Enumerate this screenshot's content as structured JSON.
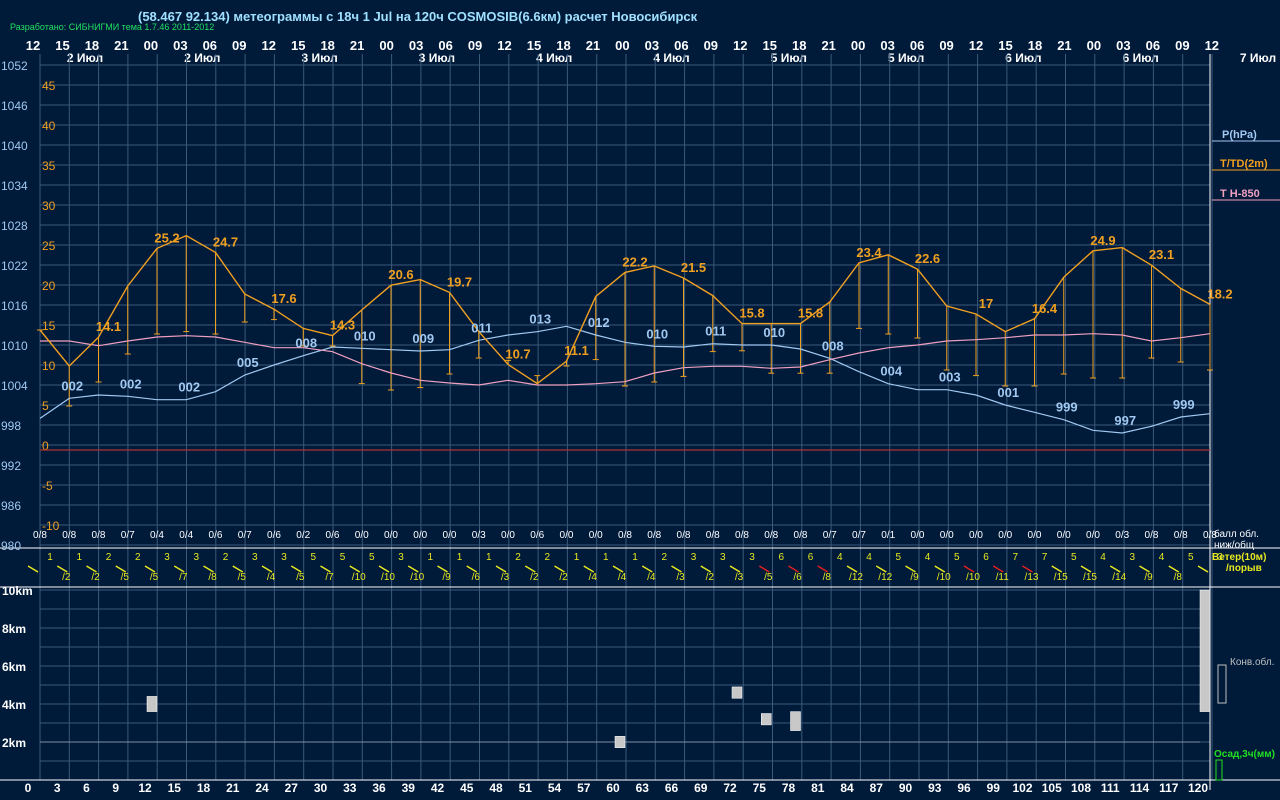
{
  "header": {
    "title": "(58.467 92.134) метеограммы с  18ч 1 Jul на 120ч COSMOSIB(6.6км) расчет Новосибирск",
    "credit": "Разработано: СИБНИГМИ тема 1.7.46 2011-2012"
  },
  "colors": {
    "bg": "#001a3a",
    "grid": "#3a5a7a",
    "pressure": "#a0c8f0",
    "temp": "#f0a020",
    "t850": "#f0a0c0",
    "wind": "#e8e820",
    "wind_strong": "#e02020",
    "cloud": "#c8c8c8",
    "precip": "#20e020",
    "zero": "#b03030",
    "text": "#ffffff",
    "label_blue": "#a0c8f0",
    "label_orange": "#f0a020",
    "label_pink": "#f0a0c0",
    "label_yellow": "#e8e820"
  },
  "chart_data": {
    "type": "line",
    "top_hours": [
      "12",
      "15",
      "18",
      "21",
      "00",
      "03",
      "06",
      "09",
      "12",
      "15",
      "18",
      "21",
      "00",
      "03",
      "06",
      "09",
      "12",
      "15",
      "18",
      "21",
      "00",
      "03",
      "06",
      "09",
      "12",
      "15",
      "18",
      "21",
      "00",
      "03",
      "06",
      "09",
      "12",
      "15",
      "18",
      "21",
      "00",
      "03",
      "06",
      "09",
      "12",
      "15",
      "18",
      "21",
      "00",
      "03",
      "06",
      "09",
      "12",
      "15",
      "18",
      "21",
      "00",
      "03",
      "06",
      "09",
      "12",
      "15",
      "18",
      "21",
      "00",
      "03",
      "06",
      "09",
      "12",
      "15",
      "18",
      "21",
      "00",
      "03",
      "06",
      "09",
      "12",
      "15",
      "18",
      "21",
      "00",
      "03",
      "06",
      "09",
      "12"
    ],
    "day_labels": [
      {
        "t": 3,
        "text": "2 Июл"
      },
      {
        "t": 27,
        "text": "2 Июл"
      },
      {
        "t": 51,
        "text": "3 Июл"
      },
      {
        "t": 75,
        "text": "3 Июл"
      },
      {
        "t": 99,
        "text": "4 Июл"
      },
      {
        "t": 123,
        "text": "4 Июл"
      },
      {
        "t": 147,
        "text": "5 Июл"
      },
      {
        "t": 171,
        "text": "5 Июл"
      },
      {
        "t": 195,
        "text": "6 Июл"
      },
      {
        "t": 219,
        "text": "6 Июл"
      },
      {
        "t": 243,
        "text": "7 Июл"
      }
    ],
    "pressure_axis": {
      "label": "P(hPa)",
      "ticks": [
        1052,
        1046,
        1040,
        1034,
        1028,
        1022,
        1016,
        1010,
        1004,
        998,
        992,
        986,
        980
      ],
      "range": [
        980,
        1052
      ]
    },
    "temp_axis": {
      "label": "T/TD(2m)",
      "ticks": [
        45,
        40,
        35,
        30,
        25,
        20,
        15,
        10,
        5,
        0,
        -5,
        -10
      ],
      "range": [
        -10,
        45
      ]
    },
    "t850_label": "T H-850",
    "hours": [
      0,
      3,
      6,
      9,
      12,
      15,
      18,
      21,
      24,
      27,
      30,
      33,
      36,
      39,
      42,
      45,
      48,
      51,
      54,
      57,
      60,
      63,
      66,
      69,
      72,
      75,
      78,
      81,
      84,
      87,
      90,
      93,
      96,
      99,
      102,
      105,
      108,
      111,
      114,
      117,
      120
    ],
    "pressure": [
      999,
      1002,
      1002.5,
      1002.3,
      1001.8,
      1001.8,
      1003,
      1005.5,
      1007,
      1008.4,
      1009.7,
      1009.5,
      1009.3,
      1009.1,
      1009.3,
      1010.7,
      1011.5,
      1012.0,
      1012.8,
      1011.5,
      1010.4,
      1009.8,
      1009.7,
      1010.2,
      1010.0,
      1010.0,
      1009.4,
      1008.0,
      1006.0,
      1004.2,
      1003.3,
      1003.3,
      1002.5,
      1001.0,
      999.9,
      998.8,
      997.2,
      996.8,
      997.8,
      999.2,
      999.7
    ],
    "pressure_labels": [
      {
        "h": 3,
        "text": "002"
      },
      {
        "h": 9,
        "text": "002"
      },
      {
        "h": 15,
        "text": "002"
      },
      {
        "h": 21,
        "text": "005"
      },
      {
        "h": 27,
        "text": "008"
      },
      {
        "h": 33,
        "text": "010"
      },
      {
        "h": 39,
        "text": "009"
      },
      {
        "h": 45,
        "text": "011"
      },
      {
        "h": 51,
        "text": "013"
      },
      {
        "h": 57,
        "text": "012"
      },
      {
        "h": 63,
        "text": "010"
      },
      {
        "h": 69,
        "text": "011"
      },
      {
        "h": 75,
        "text": "010"
      },
      {
        "h": 81,
        "text": "008"
      },
      {
        "h": 87,
        "text": "004"
      },
      {
        "h": 93,
        "text": "003"
      },
      {
        "h": 99,
        "text": "001"
      },
      {
        "h": 105,
        "text": "999"
      },
      {
        "h": 111,
        "text": "997"
      },
      {
        "h": 117,
        "text": "999"
      }
    ],
    "temp": [
      15,
      10.5,
      14.1,
      20.5,
      25.2,
      26.8,
      24.7,
      19.5,
      17.6,
      15.2,
      14.3,
      17.5,
      20.6,
      21.3,
      19.7,
      14.8,
      10.7,
      8.3,
      11.1,
      19.2,
      22.2,
      23.0,
      21.5,
      19.3,
      15.8,
      15.8,
      15.8,
      18.5,
      23.4,
      24.4,
      22.6,
      18.0,
      17,
      14.8,
      16.4,
      21.6,
      24.9,
      25.3,
      23.1,
      20.2,
      18.2
    ],
    "dewpoint": [
      15.0,
      5.5,
      8.5,
      12.0,
      14.5,
      14.8,
      14.5,
      16.0,
      16.3,
      13.0,
      13.0,
      8.3,
      7.5,
      7.8,
      9.5,
      11.5,
      11.2,
      9.3,
      10.5,
      11.3,
      8.0,
      8.5,
      9.2,
      12.3,
      12.4,
      9.6,
      9.6,
      9.6,
      15.2,
      14.5,
      14.0,
      10.0,
      9.3,
      8.0,
      8.0,
      9.5,
      9.0,
      9.0,
      11.5,
      11.0,
      10.0
    ],
    "temp_labels": [
      {
        "h": 6,
        "text": "14.1"
      },
      {
        "h": 12,
        "text": "25.2"
      },
      {
        "h": 18,
        "text": "24.7"
      },
      {
        "h": 24,
        "text": "17.6"
      },
      {
        "h": 30,
        "text": "14.3"
      },
      {
        "h": 36,
        "text": "20.6"
      },
      {
        "h": 42,
        "text": "19.7"
      },
      {
        "h": 48,
        "text": "10.7"
      },
      {
        "h": 54,
        "text": "11.1"
      },
      {
        "h": 60,
        "text": "22.2"
      },
      {
        "h": 66,
        "text": "21.5"
      },
      {
        "h": 72,
        "text": "15.8"
      },
      {
        "h": 78,
        "text": "15.8"
      },
      {
        "h": 84,
        "text": "23.4"
      },
      {
        "h": 90,
        "text": "22.6"
      },
      {
        "h": 96,
        "text": "17"
      },
      {
        "h": 102,
        "text": "16.4"
      },
      {
        "h": 108,
        "text": "24.9"
      },
      {
        "h": 114,
        "text": "23.1"
      },
      {
        "h": 120,
        "text": "18.2"
      }
    ],
    "t850": [
      1010.6,
      1010.6,
      1009.9,
      1010.6,
      1011.2,
      1011.4,
      1011.2,
      1010.4,
      1009.6,
      1009.6,
      1009.0,
      1007.2,
      1005.8,
      1004.7,
      1004.3,
      1004.0,
      1004.7,
      1004.0,
      1004.0,
      1004.2,
      1004.5,
      1005.8,
      1006.6,
      1006.8,
      1006.8,
      1006.5,
      1006.7,
      1007.8,
      1008.8,
      1009.6,
      1010.0,
      1010.6,
      1010.8,
      1011.1,
      1011.5,
      1011.5,
      1011.7,
      1011.5,
      1010.6,
      1011.1,
      1011.7
    ],
    "cloud_fractions": [
      "0/8",
      "0/8",
      "0/8",
      "0/7",
      "0/4",
      "0/4",
      "0/6",
      "0/7",
      "0/6",
      "0/2",
      "0/6",
      "0/0",
      "0/0",
      "0/0",
      "0/0",
      "0/3",
      "0/0",
      "0/6",
      "0/0",
      "0/0",
      "0/8",
      "0/8",
      "0/8",
      "0/8",
      "0/8",
      "0/8",
      "0/8",
      "0/7",
      "0/7",
      "0/1",
      "0/0",
      "0/0",
      "0/0",
      "0/0",
      "0/0",
      "0/0",
      "0/0",
      "0/3",
      "0/8",
      "0/8",
      "0/8"
    ],
    "cloud_label_1": "балл обл.",
    "cloud_label_2": "ниж/общ",
    "wind_speed": [
      "1",
      "1",
      "2",
      "2",
      "3",
      "3",
      "2",
      "3",
      "3",
      "5",
      "5",
      "5",
      "3",
      "1",
      "1",
      "1",
      "2",
      "2",
      "1",
      "1",
      "1",
      "2",
      "3",
      "3",
      "3",
      "6",
      "6",
      "4",
      "4",
      "5",
      "4",
      "5",
      "6",
      "7",
      "7",
      "5",
      "4",
      "3",
      "4",
      "5",
      "3"
    ],
    "wind_gust": [
      "/2",
      "/2",
      "/5",
      "/5",
      "/7",
      "/8",
      "/5",
      "/4",
      "/5",
      "/7",
      "/10",
      "/10",
      "/10",
      "/9",
      "/6",
      "/3",
      "/2",
      "/2",
      "/4",
      "/4",
      "/4",
      "/3",
      "/2",
      "/3",
      "/5",
      "/6",
      "/8",
      "/12",
      "/12",
      "/9",
      "/10",
      "/10",
      "/11",
      "/13",
      "/15",
      "/15",
      "/14",
      "/9",
      "/8"
    ],
    "wind_label_1": "Ветер(10м)",
    "wind_label_2": "/порыв",
    "height_axis": {
      "ticks": [
        "10km",
        "8km",
        "6km",
        "4km",
        "2km"
      ]
    },
    "conv_label": "Конв.обл.",
    "precip_label": "Осад,3ч(мм)",
    "bottom_hours": [
      "0",
      "3",
      "6",
      "9",
      "12",
      "15",
      "18",
      "21",
      "24",
      "27",
      "30",
      "33",
      "36",
      "39",
      "42",
      "45",
      "48",
      "51",
      "54",
      "57",
      "60",
      "63",
      "66",
      "69",
      "72",
      "75",
      "78",
      "81",
      "84",
      "87",
      "90",
      "93",
      "96",
      "99",
      "102",
      "105",
      "108",
      "111",
      "114",
      "117",
      "120"
    ],
    "convective": [
      {
        "h": 12,
        "bottom": 3.6,
        "top": 4.4
      },
      {
        "h": 60,
        "bottom": 1.7,
        "top": 2.3
      },
      {
        "h": 72,
        "bottom": 4.3,
        "top": 4.9
      },
      {
        "h": 75,
        "bottom": 2.9,
        "top": 3.5
      },
      {
        "h": 78,
        "bottom": 2.6,
        "top": 3.6
      },
      {
        "h": 120,
        "bottom": 3.6,
        "top": 10.0
      }
    ]
  }
}
